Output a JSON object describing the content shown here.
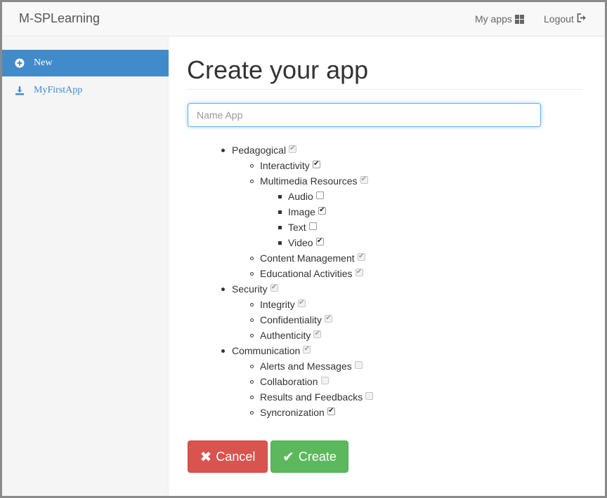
{
  "navbar": {
    "brand": "M-SPLearning",
    "my_apps_label": "My apps",
    "my_apps_icon": "grid-icon",
    "logout_label": "Logout",
    "logout_icon": "logout-icon"
  },
  "sidebar": {
    "items": [
      {
        "label": "New",
        "icon": "plus-circle-icon",
        "active": true
      },
      {
        "label": "MyFirstApp",
        "icon": "download-icon",
        "active": false
      }
    ]
  },
  "main": {
    "title": "Create your app",
    "name_input": {
      "placeholder": "Name App",
      "value": ""
    },
    "categories": [
      {
        "label": "Pedagogical",
        "checked": true,
        "disabled": true,
        "children": [
          {
            "label": "Interactivity",
            "checked": true,
            "disabled": false
          },
          {
            "label": "Multimedia Resources",
            "checked": true,
            "disabled": true,
            "children": [
              {
                "label": "Audio",
                "checked": false,
                "disabled": false
              },
              {
                "label": "Image",
                "checked": true,
                "disabled": false
              },
              {
                "label": "Text",
                "checked": false,
                "disabled": false
              },
              {
                "label": "Video",
                "checked": true,
                "disabled": false
              }
            ]
          },
          {
            "label": "Content Management",
            "checked": true,
            "disabled": true
          },
          {
            "label": "Educational Activities",
            "checked": true,
            "disabled": true
          }
        ]
      },
      {
        "label": "Security",
        "checked": true,
        "disabled": true,
        "children": [
          {
            "label": "Integrity",
            "checked": true,
            "disabled": true
          },
          {
            "label": "Confidentiality",
            "checked": true,
            "disabled": true
          },
          {
            "label": "Authenticity",
            "checked": true,
            "disabled": true
          }
        ]
      },
      {
        "label": "Communication",
        "checked": true,
        "disabled": true,
        "children": [
          {
            "label": "Alerts and Messages",
            "checked": false,
            "disabled": true
          },
          {
            "label": "Collaboration",
            "checked": false,
            "disabled": true
          },
          {
            "label": "Results and Feedbacks",
            "checked": false,
            "disabled": true
          },
          {
            "label": "Syncronization",
            "checked": true,
            "disabled": false
          }
        ]
      }
    ],
    "cancel_label": "Cancel",
    "cancel_icon": "x-icon",
    "create_label": "Create",
    "create_icon": "check-icon"
  },
  "colors": {
    "primary": "#428bca",
    "danger": "#d9534f",
    "success": "#5cb85c"
  }
}
